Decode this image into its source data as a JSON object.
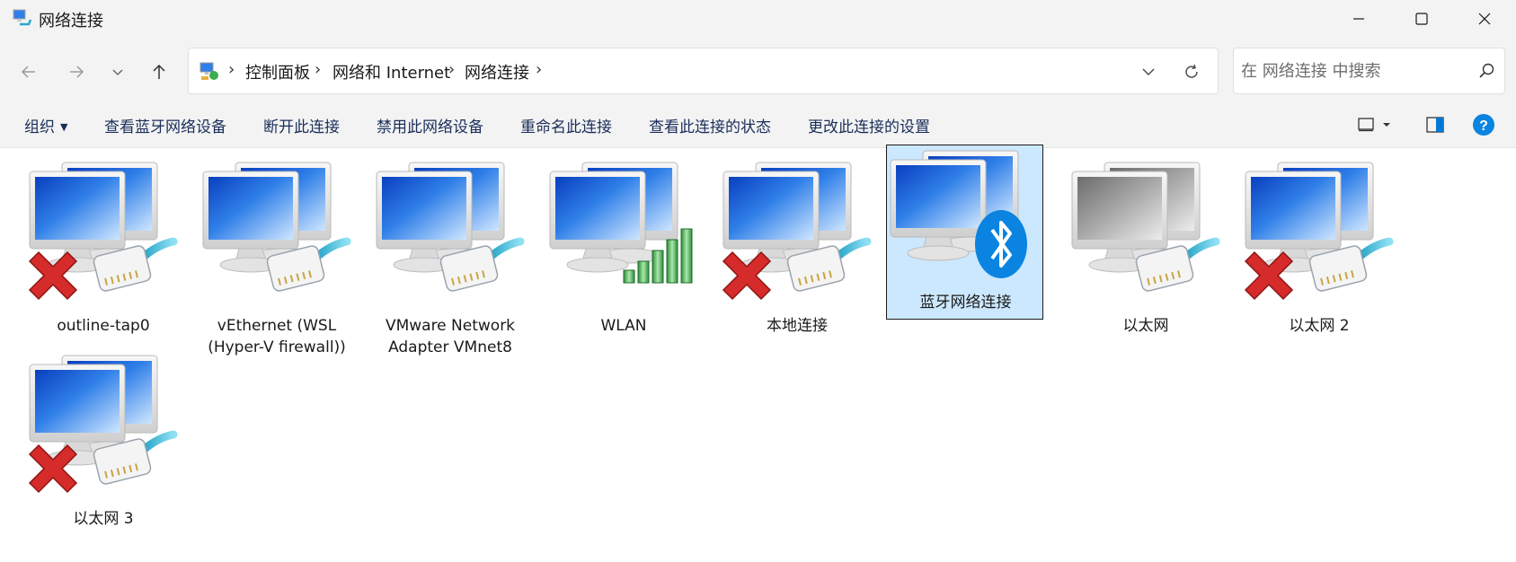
{
  "window": {
    "title": "网络连接"
  },
  "address": {
    "crumbs": [
      "控制面板",
      "网络和 Internet",
      "网络连接"
    ],
    "search_placeholder": "在 网络连接 中搜索"
  },
  "commandbar": {
    "organize": "组织",
    "view_bluetooth": "查看蓝牙网络设备",
    "disconnect": "断开此连接",
    "disable": "禁用此网络设备",
    "rename": "重命名此连接",
    "view_status": "查看此连接的状态",
    "change_settings": "更改此连接的设置"
  },
  "connections": [
    {
      "name": "outline-tap0",
      "state": "disconnected",
      "type": "ethernet"
    },
    {
      "name": "vEthernet (WSL\n(Hyper-V firewall))",
      "state": "connected",
      "type": "ethernet"
    },
    {
      "name": "VMware Network\nAdapter VMnet8",
      "state": "connected",
      "type": "ethernet"
    },
    {
      "name": "WLAN",
      "state": "connected",
      "type": "wireless"
    },
    {
      "name": "本地连接",
      "state": "disconnected",
      "type": "ethernet"
    },
    {
      "name": "蓝牙网络连接",
      "state": "connected",
      "type": "bluetooth",
      "selected": true
    },
    {
      "name": "以太网",
      "state": "disabled",
      "type": "ethernet"
    },
    {
      "name": "以太网 2",
      "state": "disconnected",
      "type": "ethernet"
    },
    {
      "name": "以太网 3",
      "state": "disconnected",
      "type": "ethernet"
    }
  ],
  "colors": {
    "accent": "#0078d4",
    "selection": "#cce8ff",
    "error_x": "#d62b2b",
    "chrome_bg": "#f3f3f3"
  }
}
